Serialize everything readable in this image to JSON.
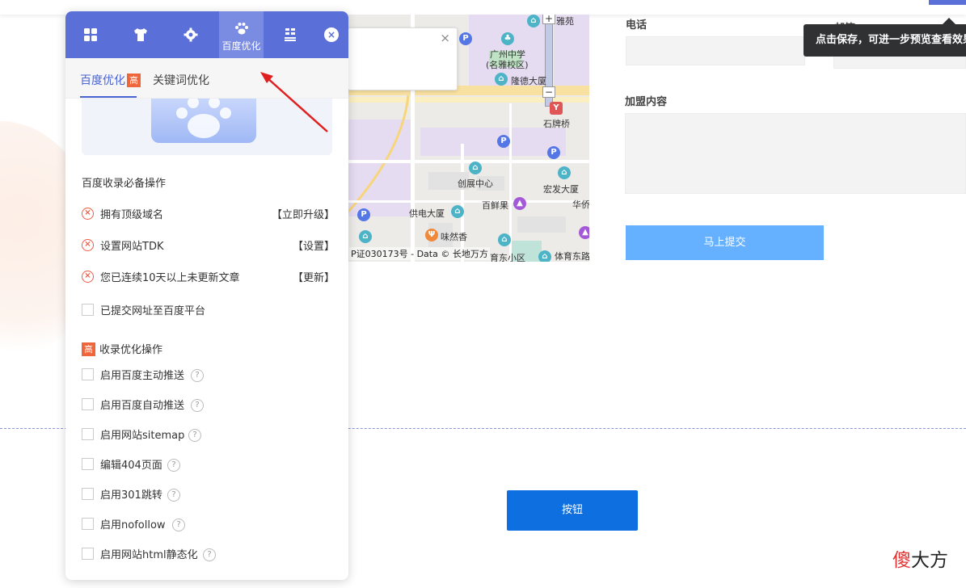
{
  "panel": {
    "tabs": [
      {
        "icon": "grid-icon",
        "label": ""
      },
      {
        "icon": "shirt-icon",
        "label": ""
      },
      {
        "icon": "gear-icon",
        "label": ""
      },
      {
        "icon": "paw-icon",
        "label": "百度优化"
      },
      {
        "icon": "layout-icon",
        "label": ""
      }
    ],
    "close_label": "×",
    "subtabs": [
      "百度优化",
      "关键词优化"
    ],
    "subtab_badge": "高",
    "section1": "百度收录必备操作",
    "required_items": [
      {
        "text": "拥有顶级域名",
        "action": "【立即升级】"
      },
      {
        "text": "设置网站TDK",
        "action": "【设置】"
      },
      {
        "text": "您已连续10天以上未更新文章",
        "action": "【更新】"
      }
    ],
    "submit_url_item": "已提交网址至百度平台",
    "section2_badge": "高",
    "section2": "收录优化操作",
    "opt_items": [
      "启用百度主动推送",
      "启用百度自动推送",
      "启用网站sitemap",
      "编辑404页面",
      "启用301跳转",
      "启用nofollow",
      "启用网站html静态化"
    ],
    "help_mark": "?"
  },
  "map": {
    "labels": [
      "雅苑",
      "广州中学",
      "(名雅校区)",
      "隆德大厦",
      "石牌桥",
      "创展中心",
      "宏发大厦",
      "供电大厦",
      "百鲜果",
      "华侨",
      "味然香",
      "育东小区",
      "体育东路"
    ],
    "credit": "P证030173号 - Data © 长地万方",
    "popup_close": "×",
    "zoom_in": "+",
    "zoom_out": "−"
  },
  "form": {
    "phone_label": "电话",
    "email_label": "邮箱",
    "content_label": "加盟内容",
    "submit_label": "马上提交"
  },
  "tooltip": "点击保存，可进一步预览查看效果",
  "button_label": "按钮",
  "watermark": {
    "first": "傻",
    "rest": "大方"
  },
  "colors": {
    "primary": "#5b6fd8",
    "badge": "#f0663c",
    "button": "#0e6fe0",
    "submit": "#66b1ff",
    "error": "#ef5a44"
  }
}
